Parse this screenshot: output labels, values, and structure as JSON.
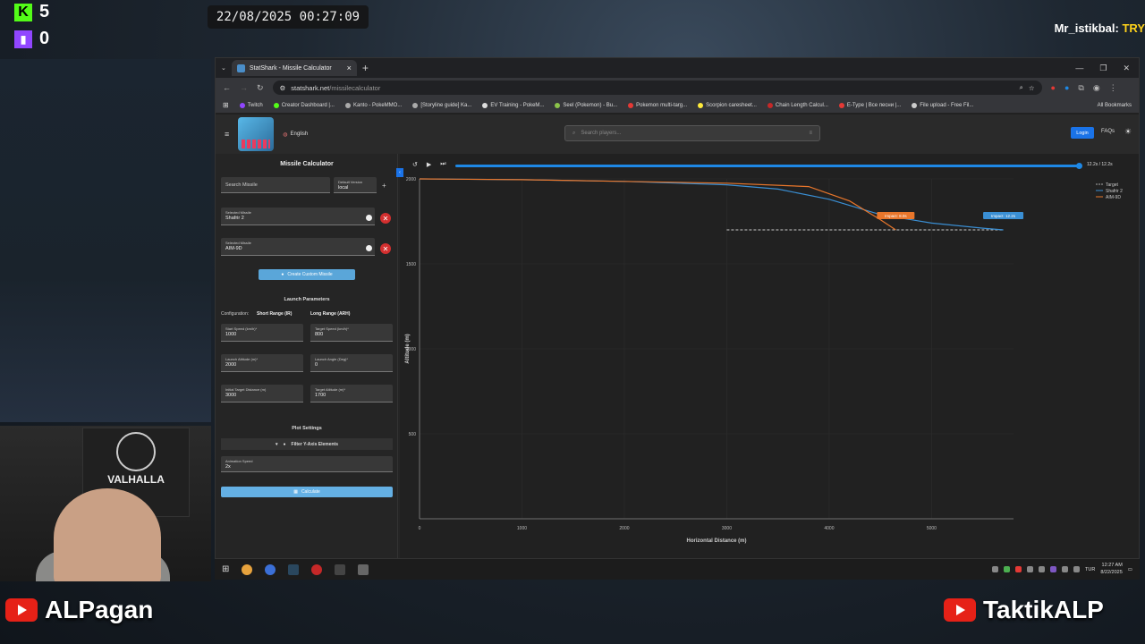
{
  "overlay": {
    "kick_count": "5",
    "twitch_count": "0",
    "clock": "22/08/2025 00:27:09",
    "ticker_name": "Mr_istikbal:",
    "ticker_text": "TRY",
    "youtube_left": "ALPagan",
    "youtube_right": "TaktikALP",
    "webcam_banner": "VALHALLA",
    "kick_icon": "K"
  },
  "browser": {
    "tab_title": "StatShark - Missile Calculator",
    "url_domain": "statshark.net",
    "url_path": "/missilecalculator",
    "bookmarks": [
      {
        "label": "Twitch",
        "color": "#9146ff"
      },
      {
        "label": "Creator Dashboard |...",
        "color": "#53fc18"
      },
      {
        "label": "Kanto - PokeMMO...",
        "color": "#aaaaaa"
      },
      {
        "label": "[Storyline guide] Ka...",
        "color": "#aaaaaa"
      },
      {
        "label": "EV Training - PokeM...",
        "color": "#dddddd"
      },
      {
        "label": "Seel (Pokemon) - Bu...",
        "color": "#8bc34a"
      },
      {
        "label": "Pokemon multi-targ...",
        "color": "#e53935"
      },
      {
        "label": "Scorpion caresheet...",
        "color": "#ffeb3b"
      },
      {
        "label": "Chain Length Calcul...",
        "color": "#c62828"
      },
      {
        "label": "E-Type | Все песни |...",
        "color": "#e53935"
      },
      {
        "label": "File upload - Free Fil...",
        "color": "#cccccc"
      }
    ],
    "all_bookmarks": "All Bookmarks"
  },
  "site": {
    "language": "English",
    "search_placeholder": "Search players...",
    "login": "Login",
    "faqs": "FAQs"
  },
  "calculator": {
    "title": "Missile Calculator",
    "search_missile": "Search Missile",
    "default_version_label": "Default Version",
    "default_version_value": "local",
    "selected_label": "Selected Missile",
    "missile_1": "Shafrir 2",
    "missile_2": "AIM-9D",
    "create_custom": "Create Custom Missile",
    "launch_params": "Launch Parameters",
    "configuration": "Configuration:",
    "short_range": "Short Range (IR)",
    "long_range": "Long Range (ARH)",
    "start_speed_label": "Start Speed (km/h)*",
    "start_speed": "1000",
    "target_speed_label": "Target Speed (km/h)*",
    "target_speed": "800",
    "launch_alt_label": "Launch Altitude (m)*",
    "launch_alt": "2000",
    "launch_angle_label": "Launch Angle (Deg)*",
    "launch_angle": "0",
    "init_dist_label": "Initial Target Distance (m)",
    "init_dist": "3000",
    "target_alt_label": "Target Altitude (m)*",
    "target_alt": "1700",
    "plot_settings": "Plot Settings",
    "filter_y": "Filter Y-Axis Elements",
    "anim_label": "Animation Speed",
    "anim_value": "2x",
    "calculate": "Calculate",
    "time_readout": "12.2s / 12.2s"
  },
  "chart_data": {
    "type": "line",
    "xlabel": "Horizontal Distance (m)",
    "ylabel": "Altitude (m)",
    "xlim": [
      0,
      5800
    ],
    "ylim": [
      0,
      2000
    ],
    "x_ticks": [
      "0",
      "1000",
      "2000",
      "3000",
      "4000",
      "5000"
    ],
    "y_ticks": [
      "500",
      "1000",
      "1500",
      "2000"
    ],
    "legend": [
      "Target",
      "Shafrir 2",
      "AIM-9D"
    ],
    "legend_position": "top-right",
    "series": [
      {
        "name": "Target",
        "color": "#aaaaaa",
        "dashed": true,
        "points": [
          [
            3000,
            1700
          ],
          [
            5700,
            1700
          ]
        ]
      },
      {
        "name": "Shafrir 2",
        "color": "#3a8fd4",
        "points": [
          [
            0,
            2000
          ],
          [
            1000,
            1995
          ],
          [
            2000,
            1985
          ],
          [
            3000,
            1965
          ],
          [
            3500,
            1940
          ],
          [
            4000,
            1880
          ],
          [
            4500,
            1790
          ],
          [
            5000,
            1740
          ],
          [
            5500,
            1710
          ],
          [
            5700,
            1700
          ]
        ]
      },
      {
        "name": "AIM-9D",
        "color": "#e8762b",
        "points": [
          [
            0,
            2000
          ],
          [
            1000,
            1995
          ],
          [
            2000,
            1985
          ],
          [
            3000,
            1975
          ],
          [
            3800,
            1955
          ],
          [
            4200,
            1870
          ],
          [
            4500,
            1760
          ],
          [
            4650,
            1700
          ]
        ]
      }
    ],
    "annotations": [
      {
        "text": "Impact: 8.0s",
        "x": 4650,
        "y": 1700,
        "color": "#e8762b"
      },
      {
        "text": "Impact: 12.2s",
        "x": 5700,
        "y": 1700,
        "color": "#3a8fd4"
      }
    ]
  },
  "taskbar": {
    "lang": "TUR",
    "time": "12:27 AM",
    "date": "8/22/2025"
  }
}
